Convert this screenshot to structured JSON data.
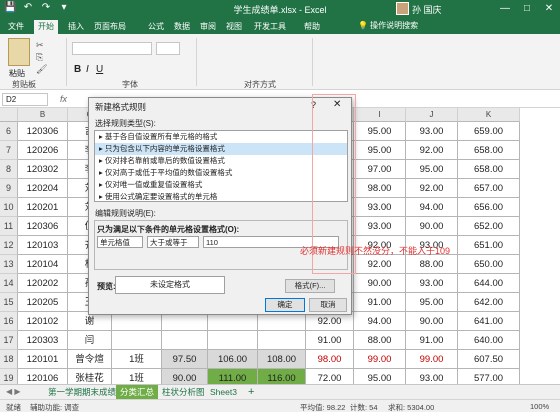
{
  "window": {
    "title": "学生成绩单.xlsx - Excel",
    "user": "孙 国庆",
    "minimize": "—",
    "restore": "□",
    "close": "✕"
  },
  "quick_access": {
    "save": "💾",
    "undo": "↶",
    "redo": "↷",
    "more": "▾"
  },
  "ribbon_tabs": [
    "文件",
    "开始",
    "插入",
    "页面布局",
    "公式",
    "数据",
    "审阅",
    "视图",
    "开发工具",
    "帮助"
  ],
  "tell_me": "💡 操作说明搜索",
  "ribbon": {
    "clipboard_group": "剪贴板",
    "font_group": "字体",
    "align_group": "对齐方式",
    "paste_label": "粘贴",
    "bold": "B",
    "italic": "I",
    "underline": "U"
  },
  "formula_bar": {
    "name_box": "D2",
    "fx": "fx"
  },
  "columns": [
    "B",
    "C",
    "D",
    "E",
    "F",
    "G",
    "H",
    "I",
    "J",
    "K"
  ],
  "rows": [
    {
      "num": "6",
      "id": "120306",
      "name": "吉",
      "cls": "",
      "v1": "",
      "v2": "",
      "v3": "",
      "v4": "87.00",
      "v5": "95.00",
      "v6": "93.00",
      "v7": "659.00"
    },
    {
      "num": "7",
      "id": "120206",
      "name": "李",
      "cls": "",
      "v1": "",
      "v2": "",
      "v3": "",
      "v4": "91.00",
      "v5": "95.00",
      "v6": "92.00",
      "v7": "658.00"
    },
    {
      "num": "8",
      "id": "120302",
      "name": "李",
      "cls": "",
      "v1": "",
      "v2": "",
      "v3": "",
      "v4": "88.00",
      "v5": "97.00",
      "v6": "95.00",
      "v7": "658.00"
    },
    {
      "num": "9",
      "id": "120204",
      "name": "刘",
      "cls": "",
      "v1": "",
      "v2": "",
      "v3": "",
      "v4": "95.00",
      "v5": "98.00",
      "v6": "92.00",
      "v7": "657.00"
    },
    {
      "num": "10",
      "id": "120201",
      "name": "刘",
      "cls": "",
      "v1": "",
      "v2": "",
      "v3": "",
      "v4": "90.00",
      "v5": "93.00",
      "v6": "94.00",
      "v7": "656.00"
    },
    {
      "num": "11",
      "id": "120306",
      "name": "倪",
      "cls": "",
      "v1": "",
      "v2": "",
      "v3": "",
      "v4": "93.00",
      "v5": "93.00",
      "v6": "90.00",
      "v7": "652.00"
    },
    {
      "num": "12",
      "id": "120103",
      "name": "齐",
      "cls": "",
      "v1": "",
      "v2": "",
      "v3": "",
      "v4": "88.00",
      "v5": "92.00",
      "v6": "93.00",
      "v7": "651.00"
    },
    {
      "num": "13",
      "id": "120104",
      "name": "杜",
      "cls": "",
      "v1": "",
      "v2": "",
      "v3": "",
      "v4": "98.00",
      "v5": "92.00",
      "v6": "88.00",
      "v7": "650.00"
    },
    {
      "num": "14",
      "id": "120202",
      "name": "孙",
      "cls": "",
      "v1": "",
      "v2": "",
      "v3": "",
      "v4": "89.00",
      "v5": "90.00",
      "v6": "93.00",
      "v7": "644.00"
    },
    {
      "num": "15",
      "id": "120205",
      "name": "王",
      "cls": "",
      "v1": "",
      "v2": "",
      "v3": "",
      "v4": "85.00",
      "v5": "91.00",
      "v6": "95.00",
      "v7": "642.00"
    },
    {
      "num": "16",
      "id": "120102",
      "name": "谢",
      "cls": "",
      "v1": "",
      "v2": "",
      "v3": "",
      "v4": "92.00",
      "v5": "94.00",
      "v6": "90.00",
      "v7": "641.00"
    },
    {
      "num": "17",
      "id": "120303",
      "name": "闫",
      "cls": "",
      "v1": "",
      "v2": "",
      "v3": "",
      "v4": "91.00",
      "v5": "88.00",
      "v6": "91.00",
      "v7": "640.00"
    },
    {
      "num": "18",
      "id": "120101",
      "name": "曾令煊",
      "cls": "1班",
      "v1": "97.50",
      "v2": "106.00",
      "v3": "108.00",
      "v4": "98.00",
      "v5": "99.00",
      "v6": "99.00",
      "v7": "607.50"
    },
    {
      "num": "19",
      "id": "120106",
      "name": "张桂花",
      "cls": "1班",
      "v1": "90.00",
      "v2": "111.00",
      "v3": "116.00",
      "v4": "72.00",
      "v5": "95.00",
      "v6": "93.00",
      "v7": "577.00"
    }
  ],
  "dialog": {
    "title": "新建格式规则",
    "help": "?",
    "close": "✕",
    "select_type_label": "选择规则类型(S):",
    "rule_types": [
      "▸ 基于各自值设置所有单元格的格式",
      "▸ 只为包含以下内容的单元格设置格式",
      "▸ 仅对排名靠前或靠后的数值设置格式",
      "▸ 仅对高于或低于平均值的数值设置格式",
      "▸ 仅对唯一值或重复值设置格式",
      "▸ 使用公式确定要设置格式的单元格"
    ],
    "edit_desc_label": "编辑规则说明(E):",
    "condition_label": "只为满足以下条件的单元格设置格式(O):",
    "field1": "单元格值",
    "field2": "大于或等于",
    "value": "110",
    "preview_label": "预览:",
    "preview_text": "未设定格式",
    "format_btn": "格式(F)...",
    "ok_btn": "确定",
    "cancel_btn": "取消"
  },
  "annotation": "必须新建规则不然没分，不能入于109",
  "sheet_tabs": [
    "第一学期期末成绩",
    "分类汇总",
    "柱状分析图",
    "Sheet3"
  ],
  "sheet_add": "+",
  "status": {
    "ready": "就绪",
    "accessibility": "辅助功能: 调查",
    "average": "平均值: 98.22",
    "count": "计数: 54",
    "sum": "求和: 5304.00",
    "zoom": "100%"
  },
  "colors": {
    "excel_green": "#217346",
    "highlight_green": "#70ad47",
    "note_red": "#e03030"
  }
}
